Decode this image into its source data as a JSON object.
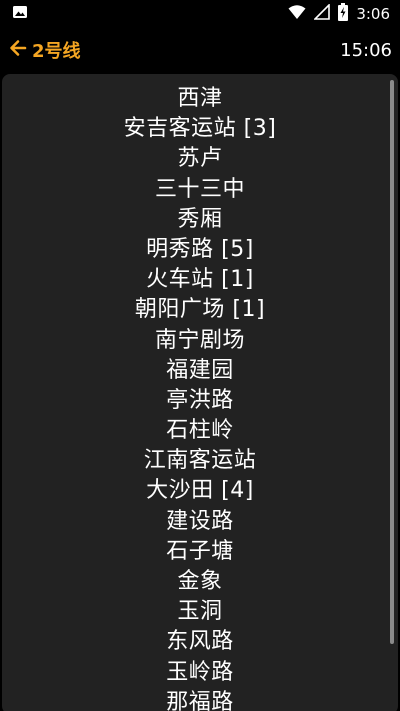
{
  "status_bar": {
    "time": "3:06",
    "icons": [
      "image-icon",
      "wifi-icon",
      "signal-icon",
      "battery-charging-icon"
    ]
  },
  "app_bar": {
    "back_label": "2号线",
    "clock": "15:06",
    "accent_color": "#f5a623"
  },
  "stations": [
    "西津",
    "安吉客运站 [3]",
    "苏卢",
    "三十三中",
    "秀厢",
    "明秀路 [5]",
    "火车站 [1]",
    "朝阳广场 [1]",
    "南宁剧场",
    "福建园",
    "亭洪路",
    "石柱岭",
    "江南客运站",
    "大沙田 [4]",
    "建设路",
    "石子塘",
    "金象",
    "玉洞",
    "东风路",
    "玉岭路",
    "那福路"
  ]
}
